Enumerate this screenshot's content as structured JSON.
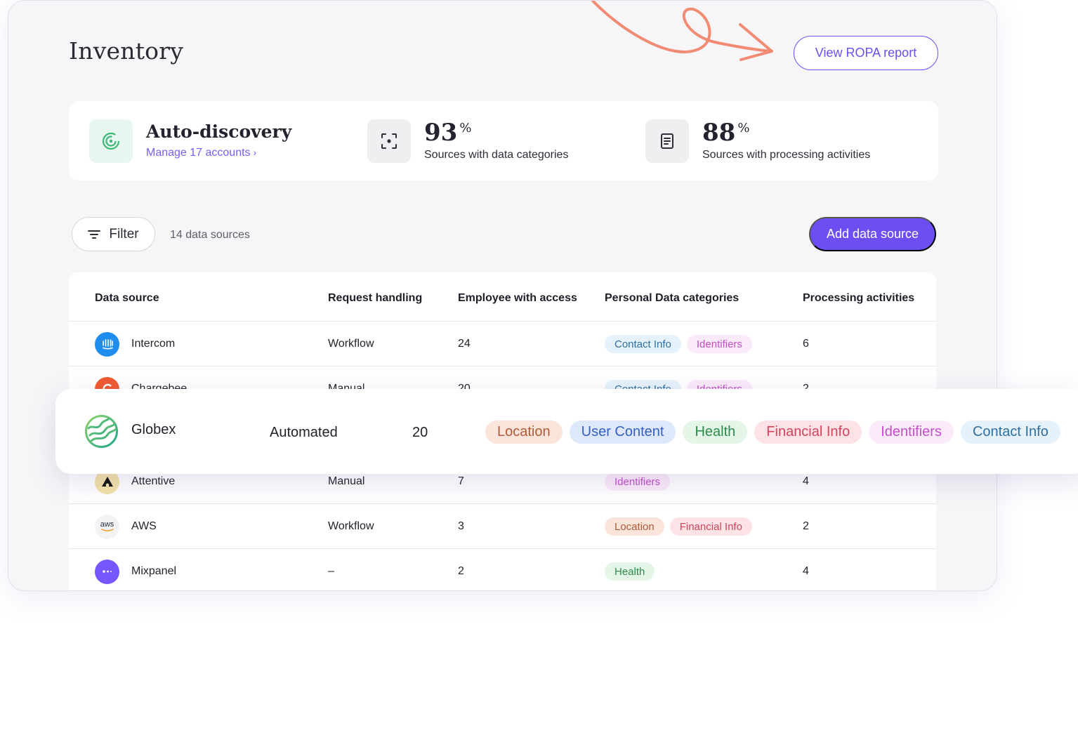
{
  "page": {
    "title": "Inventory",
    "ropa_button": "View ROPA report"
  },
  "stats": {
    "autodiscovery": {
      "title": "Auto-discovery",
      "link": "Manage 17 accounts",
      "link_chevron": "›"
    },
    "data_categories": {
      "value": "93",
      "unit": "%",
      "label": "Sources with data categories"
    },
    "processing": {
      "value": "88",
      "unit": "%",
      "label": "Sources with processing activities"
    }
  },
  "toolbar": {
    "filter_label": "Filter",
    "count_label": "14 data sources",
    "add_label": "Add data source"
  },
  "table": {
    "headers": [
      "Data source",
      "Request handling",
      "Employee with access",
      "Personal Data categories",
      "Processing activities"
    ],
    "rows": [
      {
        "name": "Intercom",
        "request": "Workflow",
        "employees": "24",
        "tags": [
          "Contact Info",
          "Identifiers"
        ],
        "activities": "6"
      },
      {
        "name": "Chargebee",
        "request": "Manual",
        "employees": "20",
        "tags": [
          "Contact Info",
          "Identifiers"
        ],
        "activities": "2"
      },
      {
        "name": "Attentive",
        "request": "Manual",
        "employees": "7",
        "tags": [
          "Identifiers"
        ],
        "activities": "4"
      },
      {
        "name": "AWS",
        "logo_text": "aws",
        "request": "Workflow",
        "employees": "3",
        "tags": [
          "Location",
          "Financial Info"
        ],
        "activities": "2"
      },
      {
        "name": "Mixpanel",
        "request": "–",
        "employees": "2",
        "tags": [
          "Health"
        ],
        "activities": "4"
      }
    ]
  },
  "highlight_row": {
    "name": "Globex",
    "request": "Automated",
    "employees": "20",
    "tags": [
      "Location",
      "User Content",
      "Health",
      "Financial Info",
      "Identifiers",
      "Contact Info"
    ]
  },
  "colors": {
    "accent": "#6c4ef2",
    "arrow": "#f28b73",
    "autodiscovery_icon": "#3cb878"
  },
  "icons": {
    "autodiscovery": "radar-icon",
    "data_categories": "focus-scan-icon",
    "processing": "document-icon",
    "filter": "filter-lines-icon"
  }
}
